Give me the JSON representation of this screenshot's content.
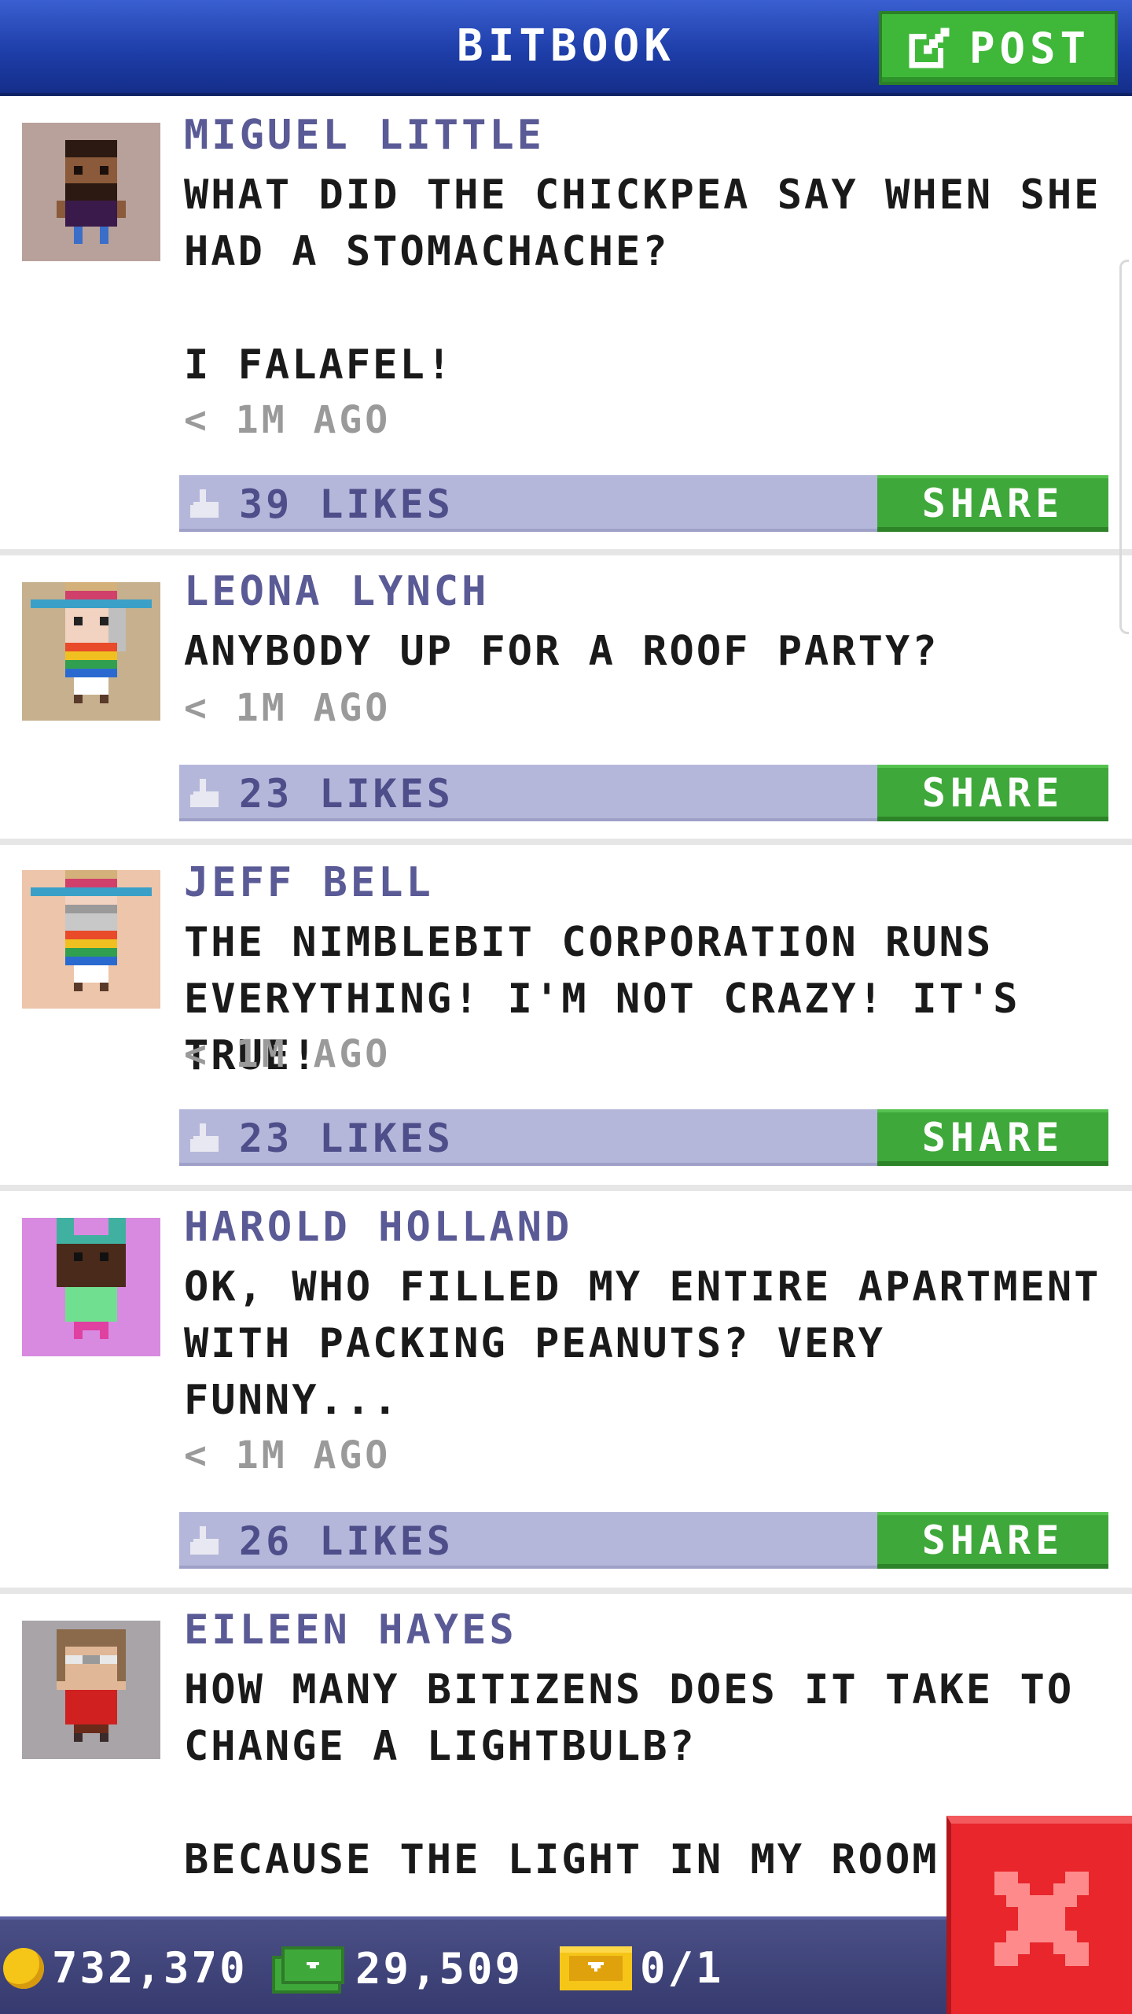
{
  "header": {
    "title": "BITBOOK",
    "post_label": "POST"
  },
  "posts": [
    {
      "author": "MIGUEL LITTLE",
      "message": "WHAT DID THE CHICKPEA SAY WHEN SHE HAD A STOMACHACHE?\n\nI FALAFEL!",
      "time": "< 1M AGO",
      "likes": "39 LIKES",
      "share_label": "SHARE",
      "avatar_bg": "#b8a19a"
    },
    {
      "author": "LEONA LYNCH",
      "message": "ANYBODY UP FOR A ROOF PARTY?",
      "time": "< 1M AGO",
      "likes": "23 LIKES",
      "share_label": "SHARE",
      "avatar_bg": "#c6b08e"
    },
    {
      "author": "JEFF BELL",
      "message": "THE NIMBLEBIT CORPORATION RUNS EVERYTHING! I'M NOT CRAZY! IT'S TRUE!",
      "time": "< 1M AGO",
      "likes": "23 LIKES",
      "share_label": "SHARE",
      "avatar_bg": "#ecc5aa"
    },
    {
      "author": "HAROLD HOLLAND",
      "message": "OK, WHO FILLED MY ENTIRE APARTMENT WITH PACKING PEANUTS? VERY FUNNY...",
      "time": "< 1M AGO",
      "likes": "26 LIKES",
      "share_label": "SHARE",
      "avatar_bg": "#d88ae0"
    },
    {
      "author": "EILEEN HAYES",
      "message": "HOW MANY BITIZENS DOES IT TAKE TO CHANGE A LIGHTBULB?\n\nBECAUSE THE LIGHT IN MY ROOM",
      "avatar_bg": "#a8a4a8"
    }
  ],
  "status": {
    "coins": "732,370",
    "bux": "29,509",
    "tickets": "0/1"
  },
  "colors": {
    "header": "#1e3ea9",
    "button_green": "#3fa83a",
    "likebar": "#b5b7da",
    "author": "#5a5a96",
    "close": "#e8262b"
  }
}
